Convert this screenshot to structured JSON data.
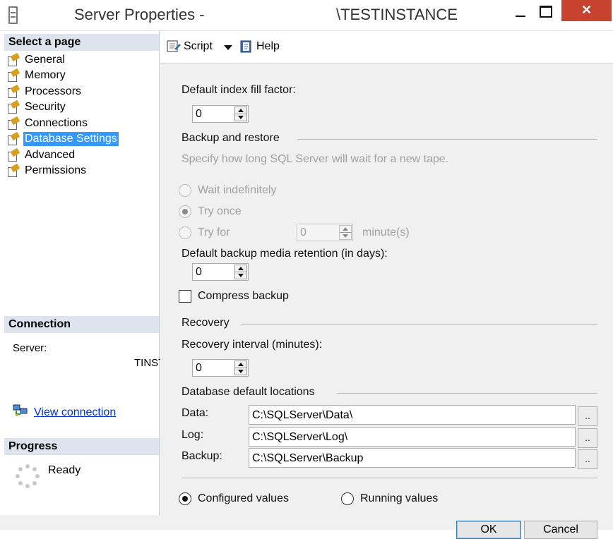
{
  "window": {
    "title_prefix": "Server Properties -",
    "title_instance": "\\TESTINSTANCE",
    "close_glyph": "✕"
  },
  "left": {
    "select_page_header": "Select a page",
    "pages": [
      {
        "label": "General"
      },
      {
        "label": "Memory"
      },
      {
        "label": "Processors"
      },
      {
        "label": "Security"
      },
      {
        "label": "Connections"
      },
      {
        "label": "Database Settings",
        "selected": true
      },
      {
        "label": "Advanced"
      },
      {
        "label": "Permissions"
      }
    ],
    "connection_header": "Connection",
    "server_label": "Server:",
    "server_value": "TINSTANCE",
    "view_connection": "View connection",
    "progress_header": "Progress",
    "progress_status": "Ready"
  },
  "toolbar": {
    "script_label": "Script",
    "help_label": "Help"
  },
  "form": {
    "fill_factor_label": "Default index fill factor:",
    "fill_factor_value": "0",
    "backup_restore_heading": "Backup and restore",
    "backup_description": "Specify how long SQL Server will wait for a new tape.",
    "wait_indefinitely": "Wait indefinitely",
    "try_once": "Try once",
    "try_for": "Try for",
    "try_for_value": "0",
    "minutes_unit": "minute(s)",
    "retention_label": "Default backup media retention (in days):",
    "retention_value": "0",
    "compress_backup": "Compress backup",
    "recovery_heading": "Recovery",
    "recovery_interval_label": "Recovery interval (minutes):",
    "recovery_interval_value": "0",
    "locations_heading": "Database default locations",
    "data_label": "Data:",
    "data_path": "C:\\SQLServer\\Data\\",
    "log_label": "Log:",
    "log_path": "C:\\SQLServer\\Log\\",
    "backup_label": "Backup:",
    "backup_path": "C:\\SQLServer\\Backup",
    "browse_label": "..",
    "configured_values": "Configured values",
    "running_values": "Running values"
  },
  "buttons": {
    "ok": "OK",
    "cancel": "Cancel"
  },
  "colors": {
    "selected_bg": "#3399ff",
    "header_bg": "#dde4ee",
    "close_button": "#c7432e",
    "link": "#0033cc"
  }
}
